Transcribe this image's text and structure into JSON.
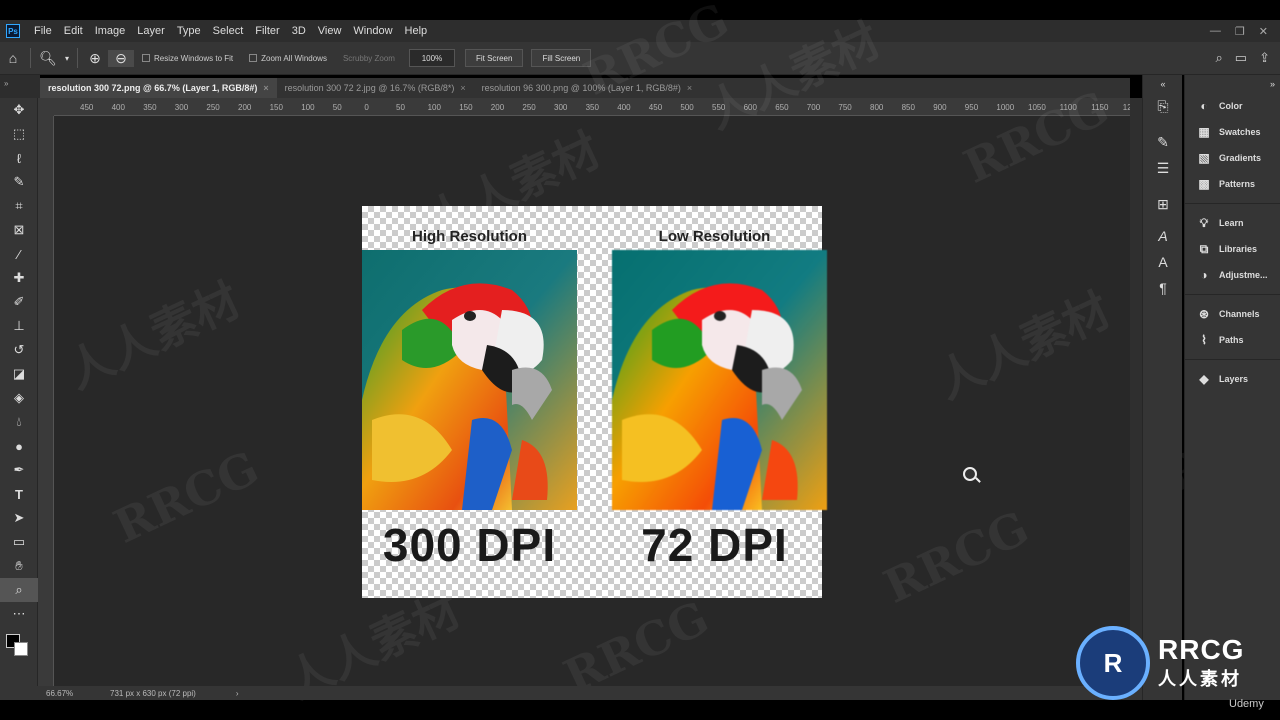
{
  "menubar": {
    "items": [
      "File",
      "Edit",
      "Image",
      "Layer",
      "Type",
      "Select",
      "Filter",
      "3D",
      "View",
      "Window",
      "Help"
    ],
    "app_icon": "photoshop-icon"
  },
  "options_bar": {
    "resize_windows": "Resize Windows to Fit",
    "zoom_all": "Zoom All Windows",
    "scrubby": "Scrubby Zoom",
    "zoom_value": "100%",
    "fit_screen": "Fit Screen",
    "fill_screen": "Fill Screen"
  },
  "tabs": [
    {
      "label": "resolution 300 72.png @ 66.7% (Layer 1, RGB/8#)",
      "active": true
    },
    {
      "label": "resolution 300 72 2.jpg @ 16.7% (RGB/8*)",
      "active": false
    },
    {
      "label": "resolution 96 300.png @ 100% (Layer 1, RGB/8#)",
      "active": false
    }
  ],
  "ruler_labels": [
    "450",
    "400",
    "350",
    "300",
    "250",
    "200",
    "150",
    "100",
    "50",
    "0",
    "50",
    "100",
    "150",
    "200",
    "250",
    "300",
    "350",
    "400",
    "450",
    "500",
    "550",
    "600",
    "650",
    "700",
    "750",
    "800",
    "850",
    "900",
    "950",
    "1000",
    "1050",
    "1100",
    "1150",
    "12"
  ],
  "document": {
    "left_heading": "High Resolution",
    "right_heading": "Low Resolution",
    "left_dpi": "300 DPI",
    "right_dpi": "72 DPI"
  },
  "status": {
    "zoom": "66.67%",
    "doc_info": "731 px x 630 px (72 ppi)"
  },
  "panels": {
    "group1": [
      "Color",
      "Swatches",
      "Gradients",
      "Patterns"
    ],
    "group2": [
      "Learn",
      "Libraries",
      "Adjustme..."
    ],
    "group3": [
      "Channels",
      "Paths"
    ],
    "group4": [
      "Layers"
    ]
  },
  "watermarks": [
    "RRCG",
    "人人素材"
  ],
  "brand": {
    "logo_text": "R",
    "line1": "RRCG",
    "line2": "人人素材",
    "udemy": "Udemy"
  }
}
